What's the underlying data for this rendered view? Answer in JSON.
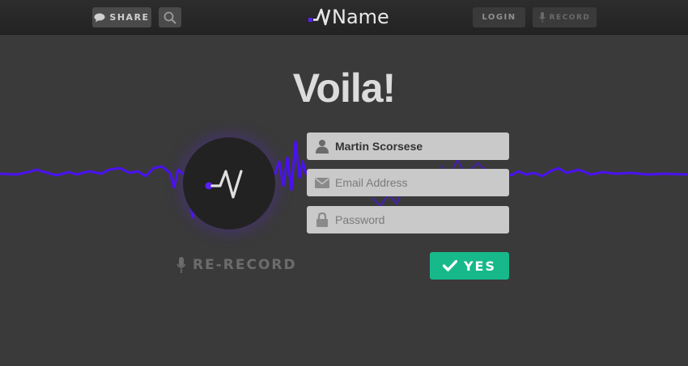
{
  "header": {
    "share_label": "SHARE",
    "login_label": "LOGIN",
    "record_label": "RECORD",
    "logo_text": "Name",
    "logo_accent_color": "#5b1fff"
  },
  "main": {
    "title": "Voila!",
    "form": {
      "name_value": "Martin Scorsese",
      "email_placeholder": "Email Address",
      "password_placeholder": "Password"
    },
    "rerecord_label": "RE-RECORD",
    "yes_label": "YES"
  },
  "colors": {
    "waveform": "#4a12f0",
    "confirm": "#17b98a",
    "background": "#3a3a3a"
  },
  "icons": [
    "chat-bubble-icon",
    "search-icon",
    "microphone-icon",
    "user-icon",
    "envelope-icon",
    "lock-icon",
    "checkmark-icon",
    "logo-mark-icon"
  ]
}
